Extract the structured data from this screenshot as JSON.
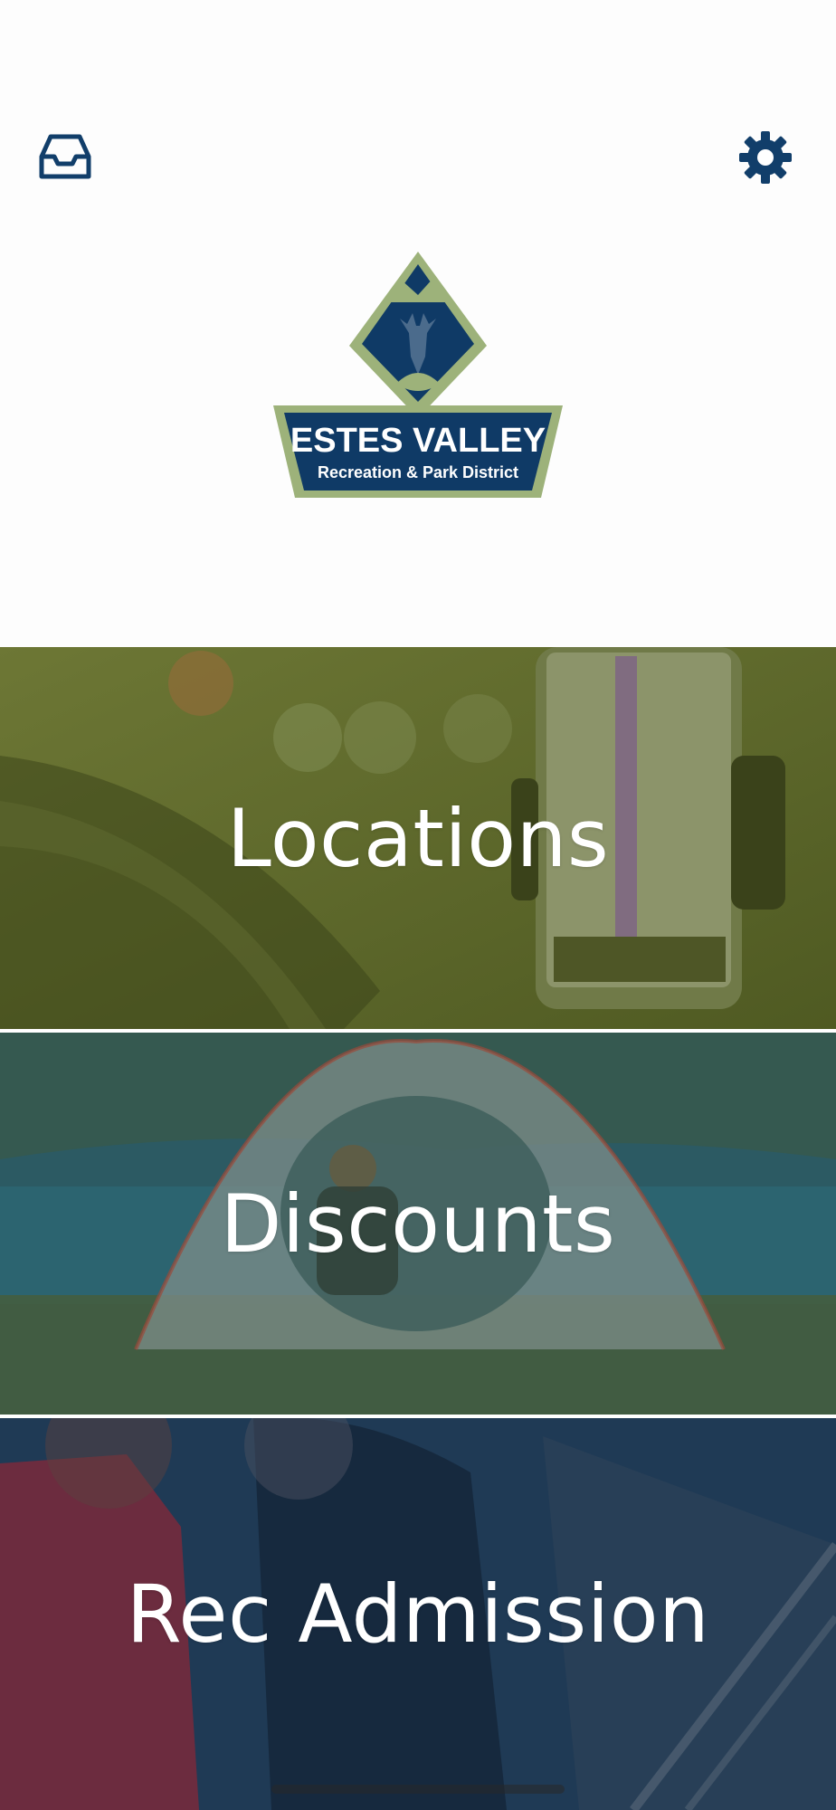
{
  "header": {
    "inbox_icon": "inbox-icon",
    "settings_icon": "gear-icon"
  },
  "logo": {
    "line1": "ESTES VALLEY",
    "line2": "Recreation & Park District",
    "colors": {
      "navy": "#0f3a66",
      "sage": "#9db27a"
    }
  },
  "tiles": [
    {
      "label": "Locations",
      "overlay": "#5e6a2e"
    },
    {
      "label": "Discounts",
      "overlay": "#2a5a66"
    },
    {
      "label": "Rec Admission",
      "overlay": "#1d3650"
    }
  ]
}
